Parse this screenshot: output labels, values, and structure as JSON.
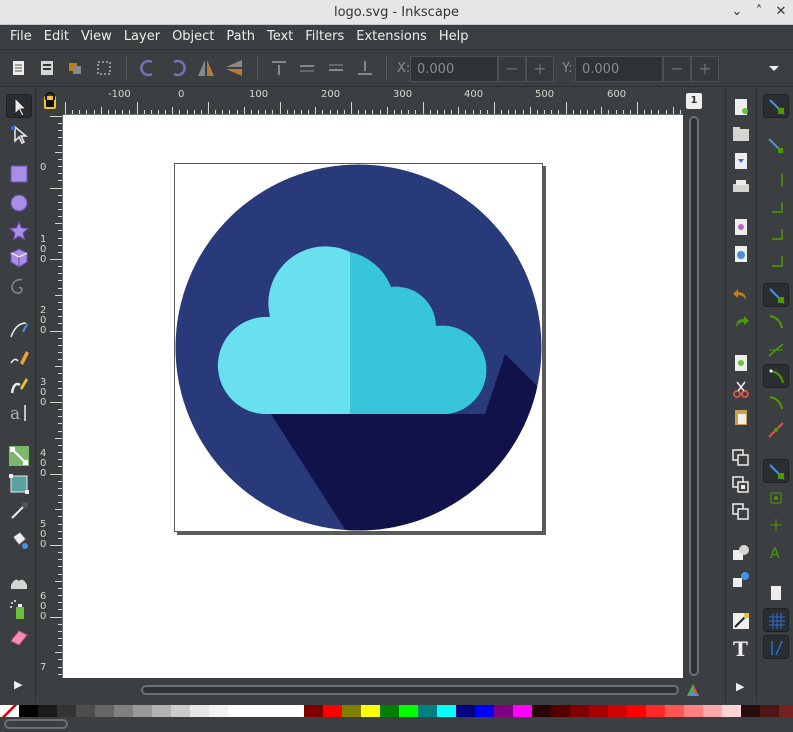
{
  "window": {
    "title": "logo.svg - Inkscape",
    "minimize_glyph": "⌄",
    "maximize_glyph": "˄",
    "close_glyph": "✕"
  },
  "menu": [
    "File",
    "Edit",
    "View",
    "Layer",
    "Object",
    "Path",
    "Text",
    "Filters",
    "Extensions",
    "Help"
  ],
  "toolbar": {
    "x_label": "X:",
    "x_value": "0.000",
    "y_label": "Y:",
    "y_value": "0.000",
    "minus": "−",
    "plus": "+",
    "overflow_icon": "dropdown-arrow-icon"
  },
  "ruler": {
    "top_labels": [
      "-100",
      "0",
      "100",
      "200",
      "300",
      "400",
      "500",
      "600"
    ],
    "left_labels": [
      "0",
      "1\n0\n0",
      "2\n0\n0",
      "3\n0\n0",
      "4\n0\n0",
      "5\n0\n0",
      "6\n0\n0",
      "7"
    ]
  },
  "page_number": "1",
  "logo": {
    "circle_color": "#283a7a",
    "shadow_color": "#12124a",
    "cloud_left_color": "#69e0ee",
    "cloud_right_color": "#37c6d9"
  },
  "tools": [
    "selector-icon",
    "node-icon",
    "rectangle-icon",
    "ellipse-icon",
    "star-icon",
    "3d-box-icon",
    "spiral-icon",
    "bezier-pen-icon",
    "pencil-icon",
    "calligraphy-icon",
    "text-icon",
    "connector-icon",
    "gradient-icon",
    "dropper-icon",
    "paint-bucket-icon",
    "tweak-icon",
    "spray-icon",
    "eraser-icon"
  ],
  "palette": [
    "#000000",
    "#1a1a1a",
    "#333333",
    "#4d4d4d",
    "#666666",
    "#808080",
    "#999999",
    "#b3b3b3",
    "#cccccc",
    "#e6e6e6",
    "#f2f2f2",
    "#ffffff",
    "#ffffff",
    "#ffffff",
    "#ffffff",
    "#800000",
    "#ff0000",
    "#808000",
    "#ffff00",
    "#008000",
    "#00ff00",
    "#008080",
    "#00ffff",
    "#000080",
    "#0000ff",
    "#800080",
    "#ff00ff",
    "#2b0000",
    "#550000",
    "#800000",
    "#aa0000",
    "#d40000",
    "#ff0000",
    "#ff2a2a",
    "#ff5555",
    "#ff8080",
    "#ffaaaa",
    "#ffd5d5",
    "#280b0b",
    "#501616",
    "#782121",
    "#a02c2c"
  ]
}
